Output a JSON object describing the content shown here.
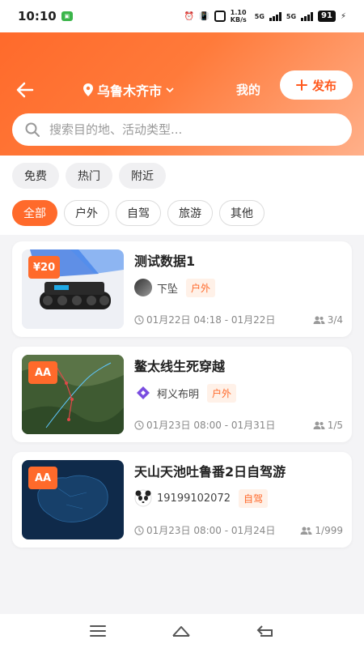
{
  "status_bar": {
    "time": "10:10",
    "net_speed": "1.10 KB/s",
    "sim1": "5G",
    "sim2": "5G",
    "battery": "91"
  },
  "header": {
    "location": "乌鲁木齐市",
    "mine_label": "我的",
    "publish_label": "发布",
    "accent_color": "#ff6a2b"
  },
  "search": {
    "placeholder": "搜索目的地、活动类型..."
  },
  "quick_filters": [
    "免费",
    "热门",
    "附近"
  ],
  "categories": [
    "全部",
    "户外",
    "自驾",
    "旅游",
    "其他"
  ],
  "activities": [
    {
      "badge": "¥20",
      "title": "测试数据1",
      "organizer": "下坠",
      "category": "户外",
      "dates": "01月22日 04:18 - 01月22日",
      "participants": "3/4"
    },
    {
      "badge": "AA",
      "title": "鳌太线生死穿越",
      "organizer": "柯义布明",
      "category": "户外",
      "dates": "01月23日 08:00 - 01月31日",
      "participants": "1/5"
    },
    {
      "badge": "AA",
      "title": "天山天池吐鲁番2日自驾游",
      "organizer": "19199102072",
      "category": "自驾",
      "dates": "01月23日 08:00 - 01月24日",
      "participants": "1/999"
    }
  ]
}
